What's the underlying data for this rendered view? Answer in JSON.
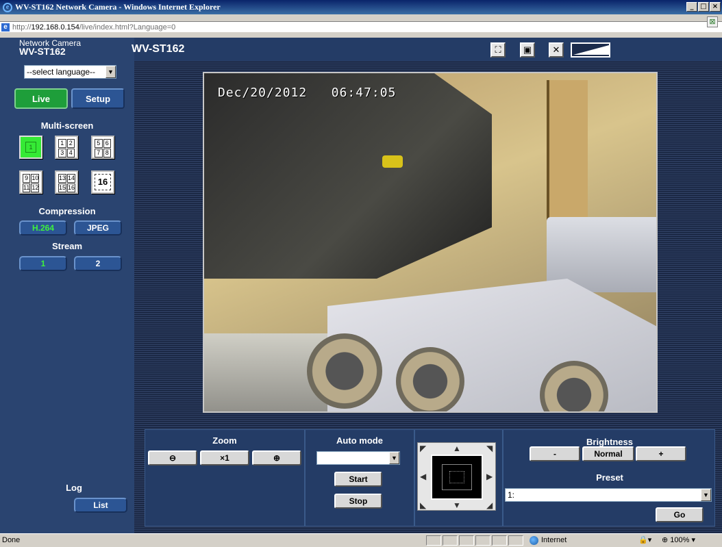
{
  "window": {
    "title": "WV-ST162 Network Camera - Windows Internet Explorer",
    "address_prefix": "http://",
    "address_host": "192.168.0.154",
    "address_path": "/live/index.html?Language=0"
  },
  "sidebar": {
    "camera_label": "Network Camera",
    "camera_model": "WV-ST162",
    "language_select": "--select language--",
    "tabs": {
      "live": "Live",
      "setup": "Setup"
    },
    "multiscreen_title": "Multi-screen",
    "multiscreen": {
      "single": "1",
      "quad1": [
        "1",
        "2",
        "3",
        "4"
      ],
      "quad2": [
        "5",
        "6",
        "7",
        "8"
      ],
      "quad3": [
        "9",
        "10",
        "11",
        "12"
      ],
      "quad4": [
        "13",
        "14",
        "15",
        "16"
      ],
      "sixteen": "16"
    },
    "compression_title": "Compression",
    "compression": {
      "h264": "H.264",
      "jpeg": "JPEG"
    },
    "stream_title": "Stream",
    "stream": {
      "s1": "1",
      "s2": "2"
    },
    "log_title": "Log",
    "log_button": "List"
  },
  "header": {
    "title": "WV-ST162"
  },
  "video": {
    "date": "Dec/20/2012",
    "time": "06:47:05"
  },
  "controls": {
    "zoom_title": "Zoom",
    "zoom_reset": "×1",
    "automode_title": "Auto mode",
    "automode_value": "",
    "start": "Start",
    "stop": "Stop",
    "brightness_title": "Brightness",
    "brightness_minus": "-",
    "brightness_normal": "Normal",
    "brightness_plus": "+",
    "preset_title": "Preset",
    "preset_value": "1:",
    "go": "Go"
  },
  "status_bar": {
    "text": "Done",
    "zone": "Internet",
    "zoom": "100%"
  },
  "colors": {
    "live_active": "#1e9e3a",
    "accent_text": "#3ef03e",
    "panel": "#243c66"
  }
}
